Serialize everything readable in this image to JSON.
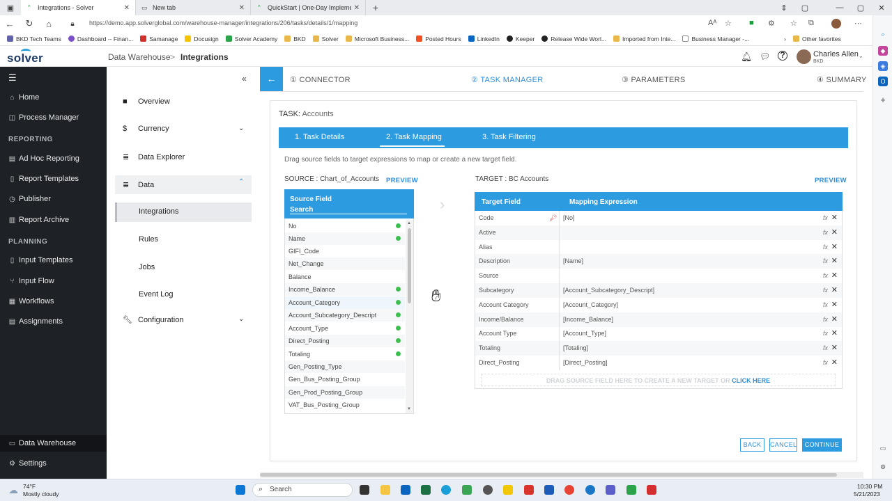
{
  "browser": {
    "tabs": [
      {
        "title": "Integrations - Solver",
        "active": true
      },
      {
        "title": "New tab",
        "active": false
      },
      {
        "title": "QuickStart | One-Day Implement",
        "active": false
      }
    ],
    "url": "https://demo.app.solverglobal.com/warehouse-manager/integrations/206/tasks/details/1/mapping",
    "bookmarks": [
      "BKD Tech Teams",
      "Dashboard -- Finan...",
      "Samanage",
      "Docusign",
      "Solver Academy",
      "BKD",
      "Solver",
      "Microsoft Business...",
      "Posted Hours",
      "LinkedIn",
      "Keeper",
      "Release Wide Worl...",
      "Imported from Inte...",
      "Business Manager -..."
    ],
    "other_favorites": "Other favorites"
  },
  "app": {
    "logo": "solver",
    "breadcrumb": {
      "parent": "Data Warehouse",
      "sep": ">",
      "current": "Integrations"
    },
    "user": {
      "name": "Charles Allen",
      "org": "BKD"
    }
  },
  "nav": {
    "home": "Home",
    "process_manager": "Process Manager",
    "reporting_header": "REPORTING",
    "ad_hoc": "Ad Hoc Reporting",
    "report_templates": "Report Templates",
    "publisher": "Publisher",
    "report_archive": "Report Archive",
    "planning_header": "PLANNING",
    "input_templates": "Input Templates",
    "input_flow": "Input Flow",
    "workflows": "Workflows",
    "assignments": "Assignments",
    "data_warehouse": "Data Warehouse",
    "settings": "Settings"
  },
  "subnav": {
    "overview": "Overview",
    "currency": "Currency",
    "data_explorer": "Data Explorer",
    "data": "Data",
    "integrations": "Integrations",
    "rules": "Rules",
    "jobs": "Jobs",
    "event_log": "Event Log",
    "configuration": "Configuration"
  },
  "wizard": {
    "steps": [
      "① CONNECTOR",
      "② TASK MANAGER",
      "③ PARAMETERS",
      "④ SUMMARY"
    ],
    "active_index": 1
  },
  "task": {
    "label": "TASK:",
    "name": "Accounts",
    "tabs": [
      "1. Task Details",
      "2. Task Mapping",
      "3. Task Filtering"
    ],
    "active_tab": 1,
    "instructions": "Drag source fields to target expressions to map or create a new target field."
  },
  "source": {
    "label": "SOURCE : Chart_of_Accounts",
    "preview": "PREVIEW",
    "header": "Source Field",
    "search_value": "Search",
    "fields": [
      {
        "name": "No",
        "mapped": true
      },
      {
        "name": "Name",
        "mapped": true
      },
      {
        "name": "GIFI_Code",
        "mapped": false
      },
      {
        "name": "Net_Change",
        "mapped": false
      },
      {
        "name": "Balance",
        "mapped": false
      },
      {
        "name": "Income_Balance",
        "mapped": true
      },
      {
        "name": "Account_Category",
        "mapped": true
      },
      {
        "name": "Account_Subcategory_Descript",
        "mapped": true
      },
      {
        "name": "Account_Type",
        "mapped": true
      },
      {
        "name": "Direct_Posting",
        "mapped": true
      },
      {
        "name": "Totaling",
        "mapped": true
      },
      {
        "name": "Gen_Posting_Type",
        "mapped": false
      },
      {
        "name": "Gen_Bus_Posting_Group",
        "mapped": false
      },
      {
        "name": "Gen_Prod_Posting_Group",
        "mapped": false
      },
      {
        "name": "VAT_Bus_Posting_Group",
        "mapped": false
      }
    ]
  },
  "target": {
    "label": "TARGET : BC Accounts",
    "preview": "PREVIEW",
    "col_field": "Target Field",
    "col_expr": "Mapping Expression",
    "rows": [
      {
        "field": "Code",
        "expr": "[No]",
        "key": true
      },
      {
        "field": "Active",
        "expr": ""
      },
      {
        "field": "Alias",
        "expr": ""
      },
      {
        "field": "Description",
        "expr": "[Name]"
      },
      {
        "field": "Source",
        "expr": ""
      },
      {
        "field": "Subcategory",
        "expr": "[Account_Subcategory_Descript]"
      },
      {
        "field": "Account Category",
        "expr": "[Account_Category]"
      },
      {
        "field": "Income/Balance",
        "expr": "[Income_Balance]"
      },
      {
        "field": "Account Type",
        "expr": "[Account_Type]"
      },
      {
        "field": "Totaling",
        "expr": "[Totaling]"
      },
      {
        "field": "Direct_Posting",
        "expr": "[Direct_Posting]"
      }
    ],
    "fx": "fx",
    "dropzone_text": "DRAG SOURCE FIELD HERE TO CREATE A NEW TARGET OR",
    "dropzone_link": "CLICK HERE"
  },
  "buttons": {
    "back": "BACK",
    "cancel": "CANCEL",
    "continue": "CONTINUE"
  },
  "taskbar": {
    "weather_temp": "74°F",
    "weather_desc": "Mostly cloudy",
    "search": "Search",
    "time": "10:30 PM",
    "date": "5/21/2023"
  },
  "colors": {
    "accent": "#2d9be0",
    "nav_bg": "#1e2227",
    "mapped_dot": "#3fbf4f"
  }
}
